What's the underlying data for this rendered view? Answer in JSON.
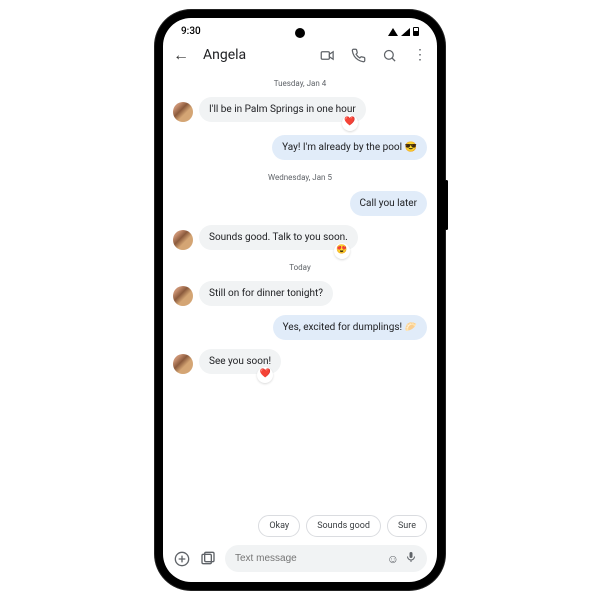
{
  "status": {
    "time": "9:30"
  },
  "header": {
    "contact": "Angela"
  },
  "dates": {
    "d1": "Tuesday, Jan 4",
    "d2": "Wednesday, Jan 5",
    "d3": "Today"
  },
  "messages": {
    "m1": "I'll be in Palm Springs in one hour",
    "m2": "Yay! I'm already by the pool 😎",
    "m3": "Call you later",
    "m4": "Sounds good. Talk to you soon.",
    "m5": "Still on for dinner tonight?",
    "m6": "Yes, excited for dumplings! 🥟",
    "m7": "See you soon!"
  },
  "reactions": {
    "r1": "❤️",
    "r4": "😍",
    "r7": "❤️"
  },
  "quick_replies": {
    "q1": "Okay",
    "q2": "Sounds good",
    "q3": "Sure"
  },
  "composer": {
    "placeholder": "Text message"
  }
}
